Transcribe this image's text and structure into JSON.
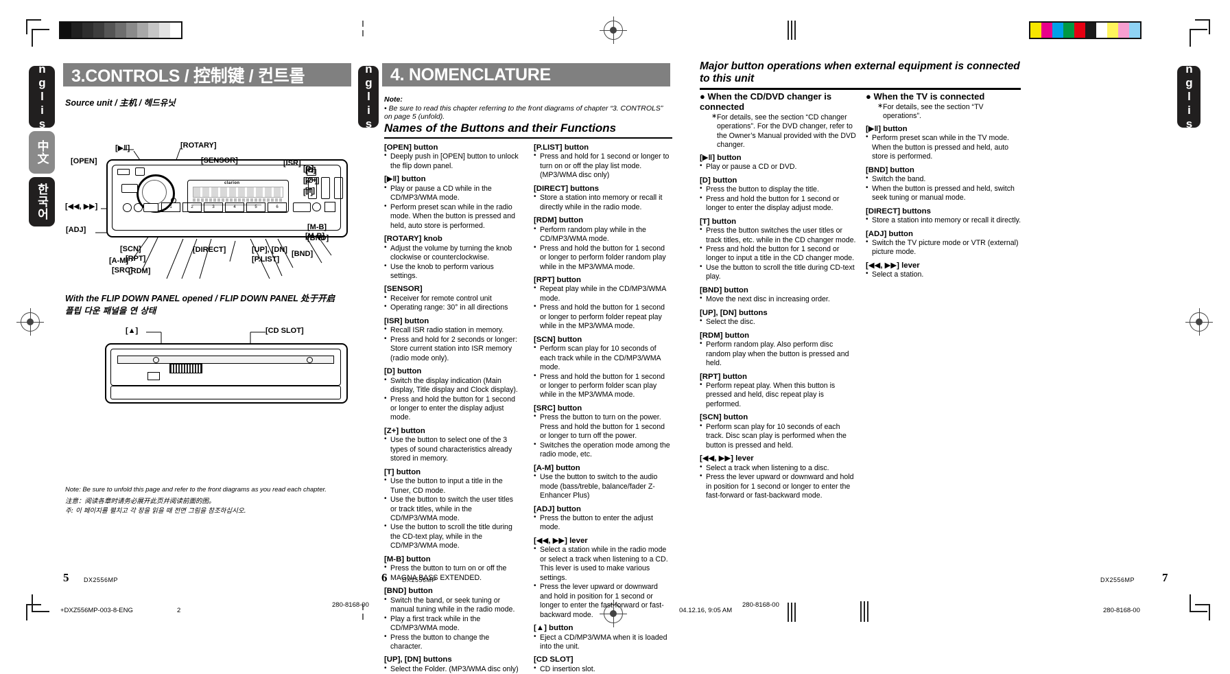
{
  "document": {
    "model": "DX2556MP",
    "doc_code": "280-8168-00",
    "file_tag": "+DXZ556MP-003-8-ENG",
    "sheet_number": "2",
    "print_timestamp": "04.12.16, 9:05 AM"
  },
  "language_tabs": [
    {
      "label": "English",
      "style": "dark"
    },
    {
      "label": "中文",
      "style": "grey"
    },
    {
      "label": "한국어",
      "style": "dark"
    },
    {
      "label": "English",
      "style": "dark"
    },
    {
      "label": "English",
      "style": "dark"
    }
  ],
  "left_page": {
    "page_number": "5",
    "banner_title": "3.CONTROLS / 控制键 / 컨트롤",
    "subhead": "Source unit / 主机 / 헤드유닛",
    "flip_subhead_en": "With the FLIP DOWN PANEL opened / FLIP DOWN PANEL 处于开启",
    "flip_subhead_kr": "플립 다운 패널을 연 상태",
    "callouts_main": [
      "[▶‖]",
      "[ROTARY]",
      "[OPEN]",
      "[SENSOR]",
      "[ISR]",
      "[◀◀, ▶▶]",
      "[ADJ]",
      "[A-M]",
      "[SRC]",
      "[SCN]",
      "[RPT]",
      "[RDM]",
      "[DIRECT]",
      "[UP], [DN]",
      "[P.LIST]",
      "[D]",
      "[Z+]",
      "[T]",
      "[M-B]",
      "[BND]"
    ],
    "callouts_flip": [
      "[▲]",
      "[CD SLOT]"
    ],
    "display_brand": "clarion",
    "notes": [
      "Note: Be sure to unfold this page and refer to the front diagrams as you read each chapter.",
      "注意：阅读各章时请务必展开此页并阅读前面的图。",
      "주: 이 페이지를 펼치고 각 장을 읽을 때 전면 그림을 참조하십시오."
    ]
  },
  "middle_page": {
    "page_number": "6",
    "banner_title": "4. NOMENCLATURE",
    "note_label": "Note:",
    "note_text": "• Be sure to read this chapter referring to the front diagrams of chapter “3. CONTROLS” on page 5 (unfold).",
    "section_title": "Names of the Buttons and their Functions",
    "column_left": [
      {
        "head": "[OPEN] button",
        "items": [
          "Deeply push in [OPEN] button to unlock the flip down panel."
        ]
      },
      {
        "head": "[▶‖] button",
        "items": [
          "Play or pause a CD while in the CD/MP3/WMA mode.",
          "Perform preset scan while in the radio mode. When the button is pressed and held, auto store is performed."
        ]
      },
      {
        "head": "[ROTARY] knob",
        "items": [
          "Adjust the volume by turning the knob clockwise or counterclockwise.",
          "Use the knob to perform various settings."
        ]
      },
      {
        "head": "[SENSOR]",
        "items": [
          "Receiver for remote control unit",
          "Operating range: 30° in all directions"
        ]
      },
      {
        "head": "[ISR] button",
        "items": [
          "Recall ISR radio station in memory.",
          "Press and hold for 2 seconds or longer: Store current station into ISR memory (radio mode only)."
        ]
      },
      {
        "head": "[D] button",
        "items": [
          "Switch the display indication (Main display, Title display and Clock display).",
          "Press and hold the button for 1 second or longer to enter the display adjust mode."
        ]
      },
      {
        "head": "[Z+] button",
        "items": [
          "Use the button to select one of the 3 types of sound characteristics already stored in memory."
        ]
      },
      {
        "head": "[T] button",
        "items": [
          "Use the button to input a title in the Tuner, CD mode.",
          "Use the button to switch the user titles or track titles, while in the CD/MP3/WMA mode.",
          "Use the button to scroll the title during the CD-text play, while in the CD/MP3/WMA mode."
        ]
      },
      {
        "head": "[M-B] button",
        "items": [
          "Press the button to turn on or off the MAGNA BASS EXTENDED."
        ]
      },
      {
        "head": "[BND] button",
        "items": [
          "Switch the band, or seek tuning or manual tuning while in the radio mode.",
          "Play a first track while in the CD/MP3/WMA mode.",
          "Press the button to change the character."
        ]
      },
      {
        "head": "[UP], [DN] buttons",
        "items": [
          "Select the Folder. (MP3/WMA disc only)"
        ]
      }
    ],
    "column_right": [
      {
        "head": "[P.LIST] button",
        "items": [
          "Press and hold for 1 second or longer to turn on or off the play list mode. (MP3/WMA disc only)"
        ]
      },
      {
        "head": "[DIRECT] buttons",
        "items": [
          "Store a station into memory or recall it directly while in the radio mode."
        ]
      },
      {
        "head": "[RDM] button",
        "items": [
          "Perform random play while in the CD/MP3/WMA mode.",
          "Press and hold the button for 1 second or longer to perform folder random play while in the MP3/WMA mode."
        ]
      },
      {
        "head": "[RPT] button",
        "items": [
          "Repeat play while in the CD/MP3/WMA mode.",
          "Press and hold the button for 1 second or longer to perform folder repeat play while in the MP3/WMA mode."
        ]
      },
      {
        "head": "[SCN] button",
        "items": [
          "Perform scan play for 10 seconds of each track while in the CD/MP3/WMA mode.",
          "Press and hold the button for 1 second or longer to perform folder scan play while in the MP3/WMA mode."
        ]
      },
      {
        "head": "[SRC] button",
        "items": [
          "Press the button to turn on the power. Press and hold the button for 1 second or longer to turn off the power.",
          "Switches the operation mode among the radio mode, etc."
        ]
      },
      {
        "head": "[A-M] button",
        "items": [
          "Use the button to switch to the audio mode (bass/treble, balance/fader Z-Enhancer Plus)"
        ]
      },
      {
        "head": "[ADJ] button",
        "items": [
          "Press the button to enter the adjust mode."
        ]
      },
      {
        "head": "[◀◀, ▶▶] lever",
        "items": [
          "Select a station while in the radio mode or select a track when listening to a CD. This lever is used to make various settings.",
          "Press the lever upward or downward and hold in position for 1 second or longer to enter the fast-forward or fast-backward mode."
        ]
      },
      {
        "head": "[▲] button",
        "items": [
          "Eject a CD/MP3/WMA when it is loaded into the unit."
        ]
      },
      {
        "head": "[CD SLOT]",
        "items": [
          "CD insertion slot."
        ]
      }
    ]
  },
  "right_page": {
    "page_number": "7",
    "heading": "Major button operations when external equipment is connected to this unit",
    "column_left": {
      "bullet_head": "When the CD/DVD changer is connected",
      "bullet_note": "For details, see the section “CD changer operations”. For the DVD changer, refer to the Owner’s Manual provided with the DVD changer.",
      "entries": [
        {
          "head": "[▶‖] button",
          "items": [
            "Play or pause a CD or DVD."
          ]
        },
        {
          "head": "[D] button",
          "items": [
            "Press the button to display the title.",
            "Press and hold the button for 1 second or longer to enter the display adjust mode."
          ]
        },
        {
          "head": "[T] button",
          "items": [
            "Press the button switches the user titles or track titles, etc. while in the CD changer mode.",
            "Press and hold the button for 1 second or longer to input a title in the CD changer mode.",
            "Use the button to scroll the title during CD-text play."
          ]
        },
        {
          "head": "[BND] button",
          "items": [
            "Move the next disc in increasing order."
          ]
        },
        {
          "head": "[UP], [DN] buttons",
          "items": [
            "Select the disc."
          ]
        },
        {
          "head": "[RDM] button",
          "items": [
            "Perform random play. Also perform disc random play when the button is pressed and held."
          ]
        },
        {
          "head": "[RPT] button",
          "items": [
            "Perform repeat play. When this button is pressed and held, disc repeat play is performed."
          ]
        },
        {
          "head": "[SCN] button",
          "items": [
            "Perform scan play for 10 seconds of each track. Disc scan play is performed when the button is pressed and held."
          ]
        },
        {
          "head": "[◀◀, ▶▶] lever",
          "items": [
            "Select a track when listening to a disc.",
            "Press the lever upward or downward and hold in position for 1 second or longer to enter the fast-forward or fast-backward mode."
          ]
        }
      ]
    },
    "column_right": {
      "bullet_head": "When the TV is connected",
      "bullet_note": "For details, see the section “TV operations”.",
      "entries": [
        {
          "head": "[▶‖] button",
          "items": [
            "Perform preset scan while in the TV mode. When the button is pressed and held, auto store is performed."
          ]
        },
        {
          "head": "[BND] button",
          "items": [
            "Switch the band.",
            "When the button is pressed and held, switch seek tuning or manual mode."
          ]
        },
        {
          "head": "[DIRECT] buttons",
          "items": [
            "Store a station into memory or recall it directly."
          ]
        },
        {
          "head": "[ADJ] button",
          "items": [
            "Switch the TV picture mode or VTR (external) picture mode."
          ]
        },
        {
          "head": "[◀◀, ▶▶] lever",
          "items": [
            "Select a station."
          ]
        }
      ]
    }
  },
  "color_bars": {
    "greyscale": [
      "#0d0d0d",
      "#1f1f1f",
      "#2e2e2e",
      "#3d3d3d",
      "#555555",
      "#6e6e6e",
      "#8a8a8a",
      "#a8a8a8",
      "#c6c6c6",
      "#e2e2e2",
      "#ffffff"
    ],
    "process": [
      "#f7e600",
      "#ea0089",
      "#00a0e9",
      "#009944",
      "#e60012",
      "#1a1a1a",
      "#ffffff",
      "#fff45c",
      "#f79fd0",
      "#8fd3f4"
    ]
  }
}
